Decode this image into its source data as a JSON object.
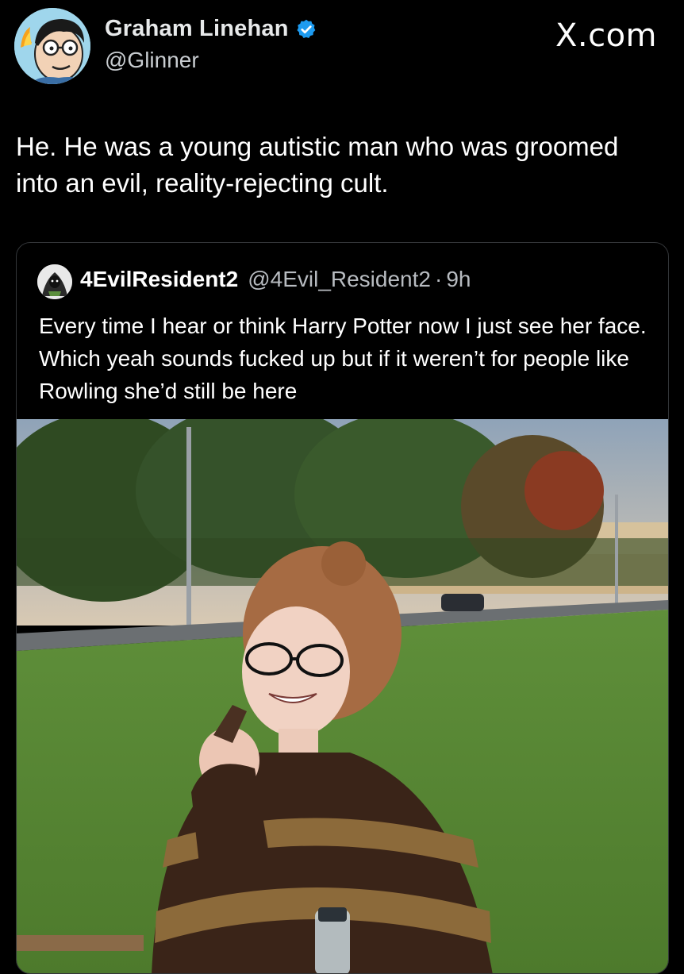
{
  "author": {
    "name": "Graham Linehan",
    "handle": "@Glinner"
  },
  "site_label": "X.com",
  "tweet": {
    "text": "He. He was a young autistic man who was groomed into an evil, reality-rejecting cult."
  },
  "quoted": {
    "name": "4EvilResident2",
    "handle": "@4Evil_Resident2",
    "separator": "·",
    "time": "9h",
    "text": "Every time I hear or think Harry Potter now I just see her face. Which yeah sounds fucked up but if it weren’t for people like Rowling she’d still be here"
  },
  "colors": {
    "background": "#000000",
    "verified_badge": "#1d9bf0",
    "text_primary": "#ffffff",
    "text_secondary": "#b8bcc1",
    "card_border": "#333639"
  },
  "icons": {
    "verified": "verified-badge-icon"
  }
}
